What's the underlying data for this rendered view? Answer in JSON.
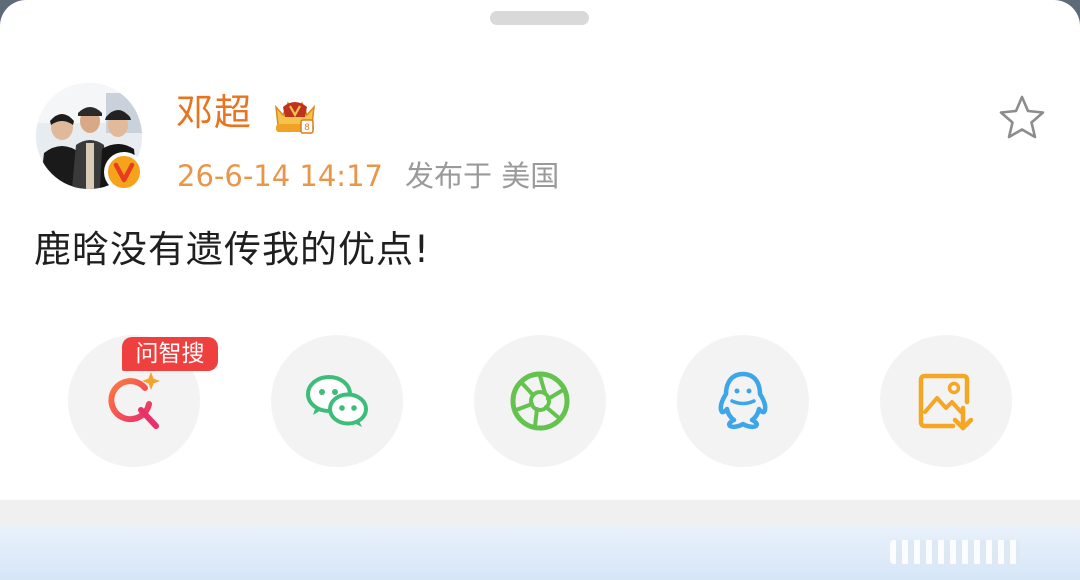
{
  "post": {
    "username": "邓超",
    "time": "26-6-14 14:17",
    "location": "发布于 美国",
    "text": "鹿晗没有遗传我的优点!"
  },
  "share_actions": [
    {
      "name": "问智搜",
      "tag": "问智搜",
      "icon": "ai-search-icon",
      "color": "#ef4a5a"
    },
    {
      "name": "wechat",
      "icon": "wechat-icon",
      "color": "#3dbc7a"
    },
    {
      "name": "moments",
      "icon": "moments-icon",
      "color": "#63c34e"
    },
    {
      "name": "qq",
      "icon": "qq-icon",
      "color": "#3ea6e8"
    },
    {
      "name": "save-image",
      "icon": "save-image-icon",
      "color": "#f5a623"
    }
  ],
  "colors": {
    "username": "#e8741f",
    "time": "#e8964a",
    "tag_bg": "#ef4040"
  }
}
